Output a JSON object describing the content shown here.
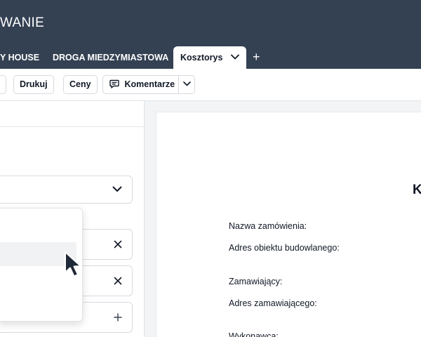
{
  "app": {
    "title": "WANIE"
  },
  "tabs": [
    {
      "label": "Y HOUSE"
    },
    {
      "label": "DROGA MIEDZYMIASTOWA"
    },
    {
      "label": "Kosztorys"
    }
  ],
  "tab_add_label": "+",
  "toolbar": {
    "print_label": "Drukuj",
    "prices_label": "Ceny",
    "comments_label": "Komentarze"
  },
  "document": {
    "heading": "K",
    "fields": [
      "Nazwa zamówienia:",
      "Adres obiektu budowlanego:",
      "Zamawiający:",
      "Adres zamawiającego:",
      "Wykonawca:"
    ]
  },
  "colors": {
    "header_bg": "#344153",
    "panel_bg": "#ffffff",
    "canvas_bg": "#f3f4f6",
    "border": "#d6dae0"
  }
}
